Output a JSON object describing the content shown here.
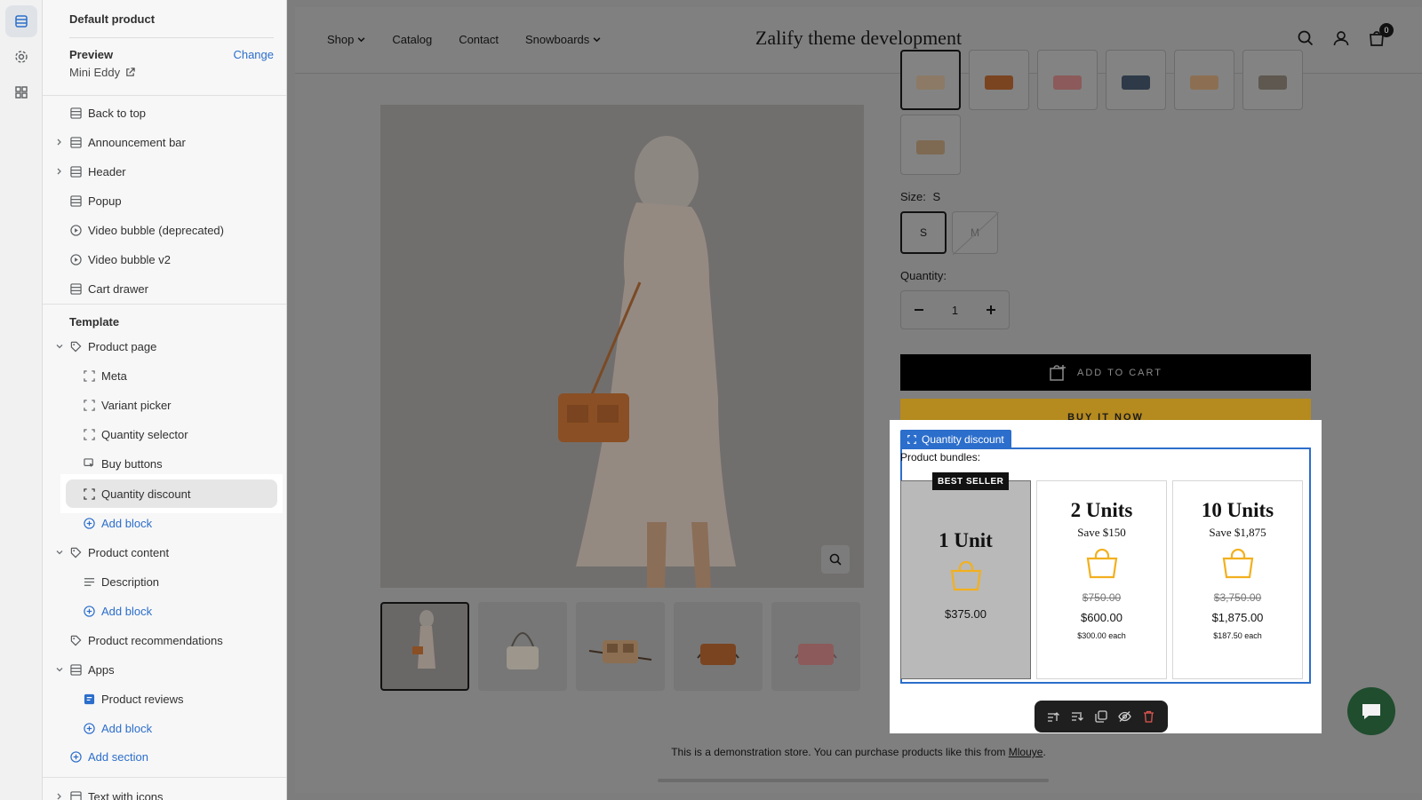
{
  "sidebar": {
    "title": "Default product",
    "preview_label": "Preview",
    "change_label": "Change",
    "preview_value": "Mini Eddy",
    "header_items": [
      {
        "label": "Back to top"
      },
      {
        "label": "Announcement bar"
      },
      {
        "label": "Header"
      },
      {
        "label": "Popup"
      },
      {
        "label": "Video bubble (deprecated)"
      },
      {
        "label": "Video bubble v2"
      },
      {
        "label": "Cart drawer"
      }
    ],
    "template_title": "Template",
    "product_page": "Product page",
    "product_page_blocks": [
      "Meta",
      "Variant picker",
      "Quantity selector",
      "Buy buttons",
      "Quantity discount"
    ],
    "add_block": "Add block",
    "product_content": "Product content",
    "description": "Description",
    "product_recommendations": "Product recommendations",
    "apps": "Apps",
    "product_reviews": "Product reviews",
    "add_section": "Add section",
    "text_with_icons": "Text with icons"
  },
  "store": {
    "nav": [
      "Shop",
      "Catalog",
      "Contact",
      "Snowboards"
    ],
    "brand": "Zalify theme development",
    "cart_count": "0",
    "size_label": "Size:",
    "size_value": "S",
    "sizes": [
      "S",
      "M"
    ],
    "quantity_label": "Quantity:",
    "quantity_value": "1",
    "add_to_cart": "ADD TO CART",
    "buy_now": "BUY IT NOW",
    "block_tag": "Quantity discount",
    "bundles_title": "Product bundles:",
    "best_seller": "BEST SELLER",
    "bundles": [
      {
        "units": "1 Unit",
        "price": "$375.00"
      },
      {
        "units": "2 Units",
        "save": "Save $150",
        "old": "$750.00",
        "price": "$600.00",
        "each": "$300.00 each"
      },
      {
        "units": "10 Units",
        "save": "Save $1,875",
        "old": "$3,750.00",
        "price": "$1,875.00",
        "each": "$187.50 each"
      }
    ],
    "demo_note": "This is a demonstration store. You can purchase products like this from ",
    "demo_link": "Mlouye",
    "demo_end": "."
  },
  "colors": {
    "accent": "#2c6ecb",
    "bag_icon": "#f2b01e",
    "buy_now": "#b58a1e",
    "chat": "#1f4d2e"
  }
}
